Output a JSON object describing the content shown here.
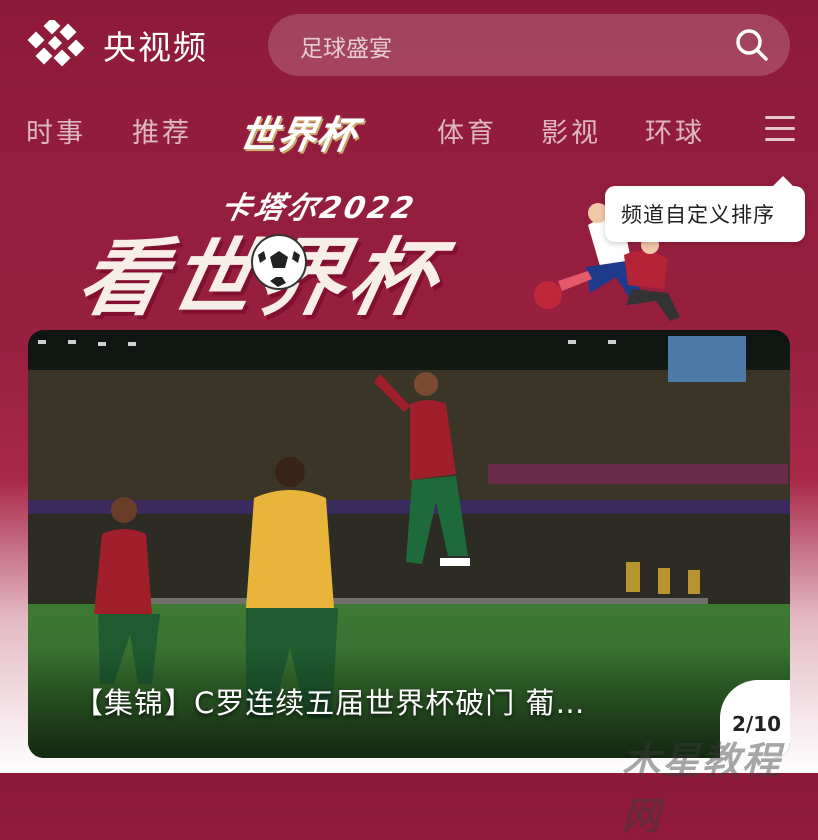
{
  "app": {
    "brand": "央视频"
  },
  "search": {
    "placeholder": "足球盛宴"
  },
  "nav": {
    "items": [
      "时事",
      "推荐",
      "世界杯",
      "体育",
      "影视",
      "环球"
    ]
  },
  "banner": {
    "subtitle": "卡塔尔2022",
    "title": "看世界杯"
  },
  "tooltip": {
    "text": "频道自定义排序"
  },
  "feature": {
    "caption": "【集锦】C罗连续五届世界杯破门 葡…",
    "counter": "2/10"
  },
  "watermark": "木星教程网",
  "colors": {
    "background": "#8e1a3a",
    "accent": "#ffffff"
  },
  "icons": {
    "logo": "cctv-video-logo",
    "search": "search-icon",
    "menu": "menu-icon"
  }
}
